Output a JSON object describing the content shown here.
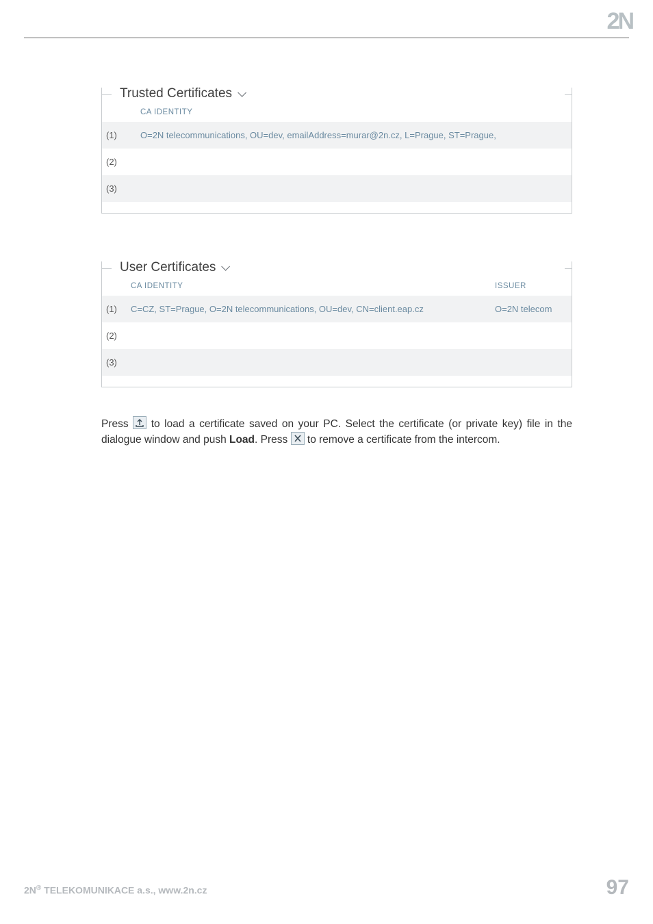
{
  "brand": {
    "logo_text": "2N"
  },
  "trusted": {
    "title": "Trusted Certificates",
    "col_identity": "CA IDENTITY",
    "rows": [
      {
        "n": "(1)",
        "identity": "O=2N telecommunications, OU=dev, emailAddress=murar@2n.cz, L=Prague, ST=Prague,"
      },
      {
        "n": "(2)",
        "identity": ""
      },
      {
        "n": "(3)",
        "identity": ""
      }
    ]
  },
  "user": {
    "title": "User Certificates",
    "col_identity": "CA IDENTITY",
    "col_issuer": "ISSUER",
    "rows": [
      {
        "n": "(1)",
        "identity": "C=CZ, ST=Prague, O=2N telecommunications, OU=dev, CN=client.eap.cz",
        "issuer": "O=2N telecom"
      },
      {
        "n": "(2)",
        "identity": "",
        "issuer": ""
      },
      {
        "n": "(3)",
        "identity": "",
        "issuer": ""
      }
    ]
  },
  "desc": {
    "t1": "Press ",
    "t2": " to load a certificate saved on your PC. Select the certificate (or private key) file in the dialogue window and push ",
    "load": "Load",
    "t3": ". Press ",
    "t4": " to remove a certificate from the intercom."
  },
  "footer": {
    "company": "2N",
    "reg": "®",
    "rest": " TELEKOMUNIKACE a.s., www.2n.cz",
    "page": "97"
  }
}
